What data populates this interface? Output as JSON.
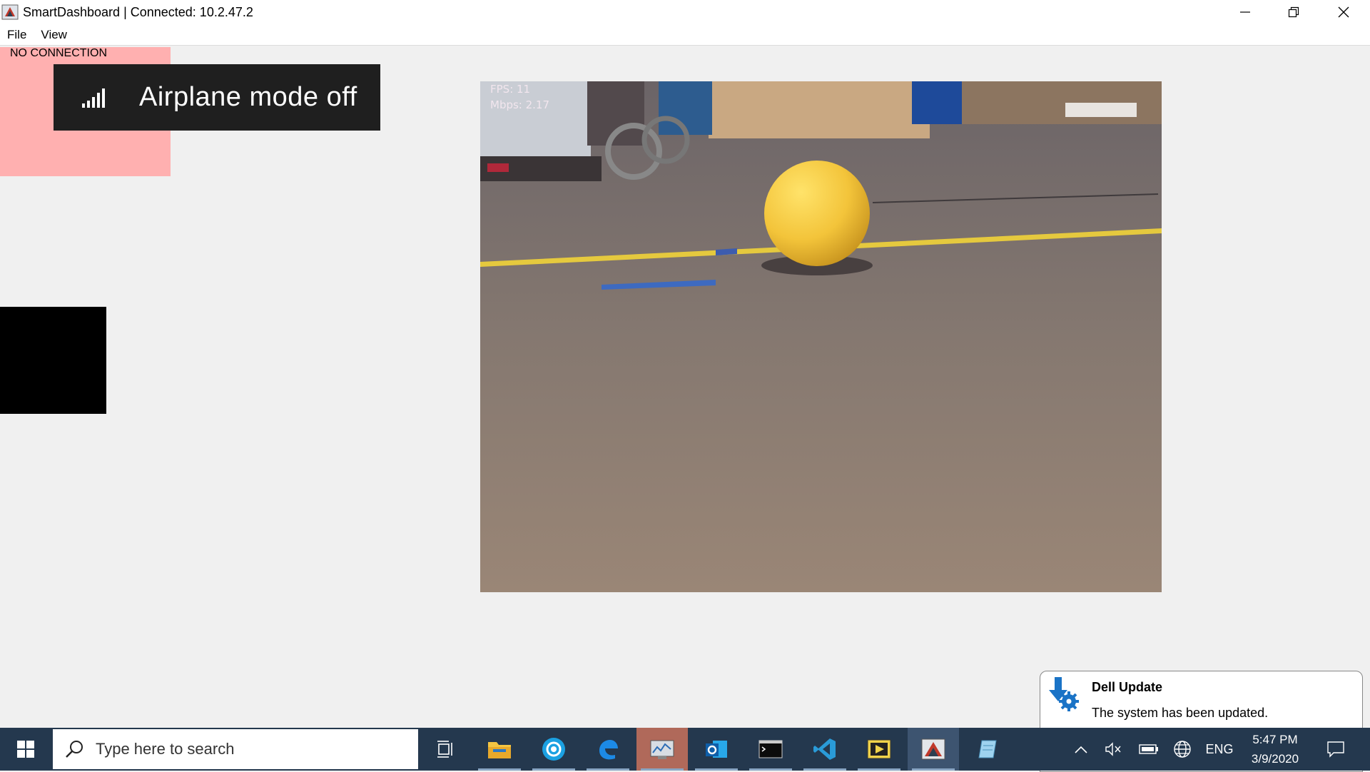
{
  "window": {
    "title": "SmartDashboard | Connected: 10.2.47.2",
    "controls": {
      "minimize": "minimize-icon",
      "restore": "restore-icon",
      "close": "close-icon"
    }
  },
  "menu": {
    "items": [
      "File",
      "View"
    ]
  },
  "widgets": {
    "connection_indicator": {
      "label": "NO CONNECTION",
      "color": "#ffb0b0"
    },
    "black_widget": {
      "color": "#000000"
    }
  },
  "airplane_toast": {
    "text": "Airplane mode off",
    "icon": "signal-bars-icon"
  },
  "camera": {
    "fps": "FPS: 11",
    "mbps": "Mbps: 2.17"
  },
  "dell_toast": {
    "title": "Dell Update",
    "body": "The system has been updated.",
    "icon": "dell-update-icon"
  },
  "taskbar": {
    "search_placeholder": "Type here to search",
    "apps": [
      "task-view-icon",
      "file-explorer-icon",
      "camera-app-icon",
      "edge-icon",
      "driver-station-icon",
      "outlook-icon",
      "terminal-icon",
      "vscode-icon",
      "labview-icon",
      "smartdashboard-icon",
      "notepad-icon"
    ],
    "tray": {
      "lang": "ENG",
      "time": "5:47 PM",
      "date": "3/9/2020"
    }
  },
  "colors": {
    "taskbar": "#24384e",
    "accent": "#b0695a",
    "ball": "#f5c83a",
    "floor": "#7e746f"
  }
}
